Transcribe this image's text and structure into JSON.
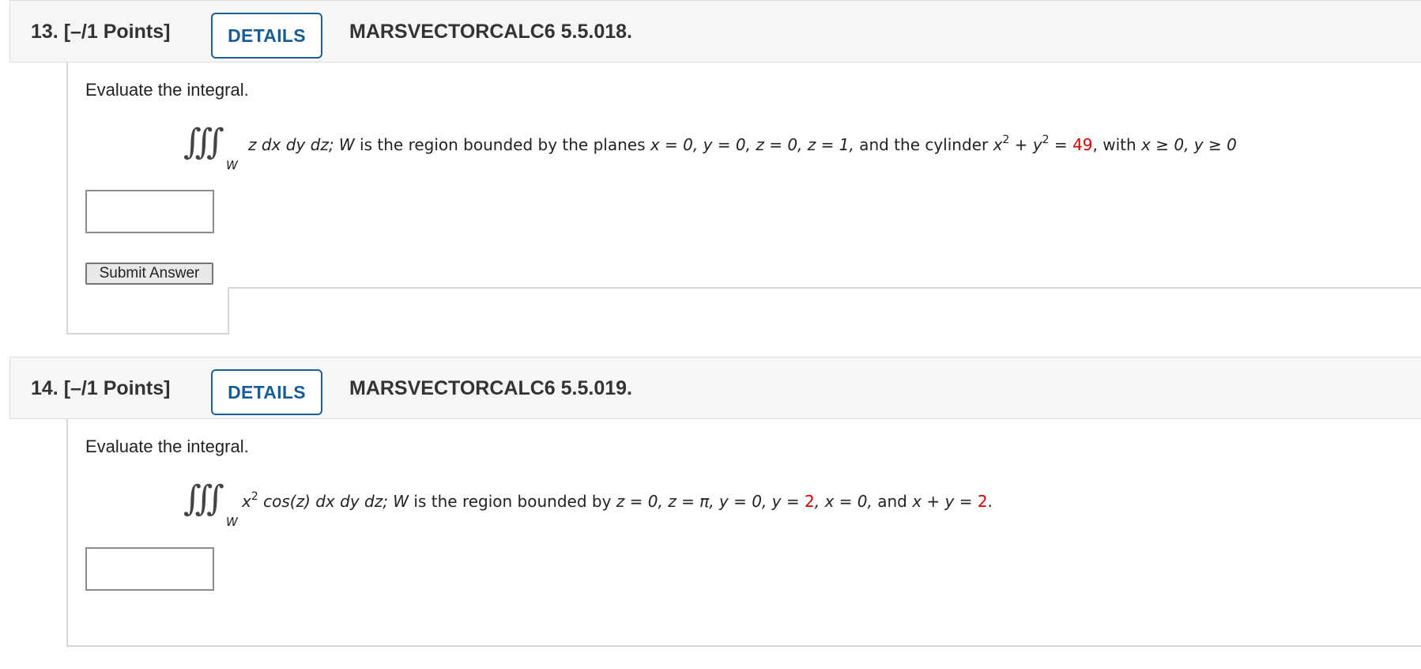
{
  "questions": [
    {
      "number_points": "13.  [–/1 Points]",
      "details_label": "DETAILS",
      "reference": "MARSVECTORCALC6 5.5.018.",
      "prompt": "Evaluate the integral.",
      "integral_symbol": "∭",
      "region_sub": "W",
      "equation": {
        "integrand": "z dx dy dz; W",
        "text_1": " is the region bounded by the planes ",
        "text_2": "x = 0, y = 0, z = 0, z = 1,",
        "text_3": " and the cylinder ",
        "lhs": "x",
        "exp1": "2",
        "plus": " + ",
        "y": "y",
        "exp2": "2",
        "eq": " = ",
        "value": "49",
        "text_4": ", with ",
        "cond": "x ≥ 0, y ≥ 0"
      },
      "submit_label": "Submit Answer"
    },
    {
      "number_points": "14.  [–/1 Points]",
      "details_label": "DETAILS",
      "reference": "MARSVECTORCALC6 5.5.019.",
      "prompt": "Evaluate the integral.",
      "integral_symbol": "∭",
      "region_sub": "W",
      "equation": {
        "lhs": "x",
        "exp1": "2",
        "integrand": " cos(z) dx dy dz; W",
        "text_1": " is the region bounded by ",
        "text_2": "z = 0, z = π, y = 0, y = ",
        "value1": "2",
        "text_3": ", x = 0,",
        "text_4": " and ",
        "text_5": "x + y = ",
        "value2": "2",
        "text_6": "."
      }
    }
  ],
  "colors": {
    "accent": "#1a5d95",
    "highlight": "#d80000"
  }
}
